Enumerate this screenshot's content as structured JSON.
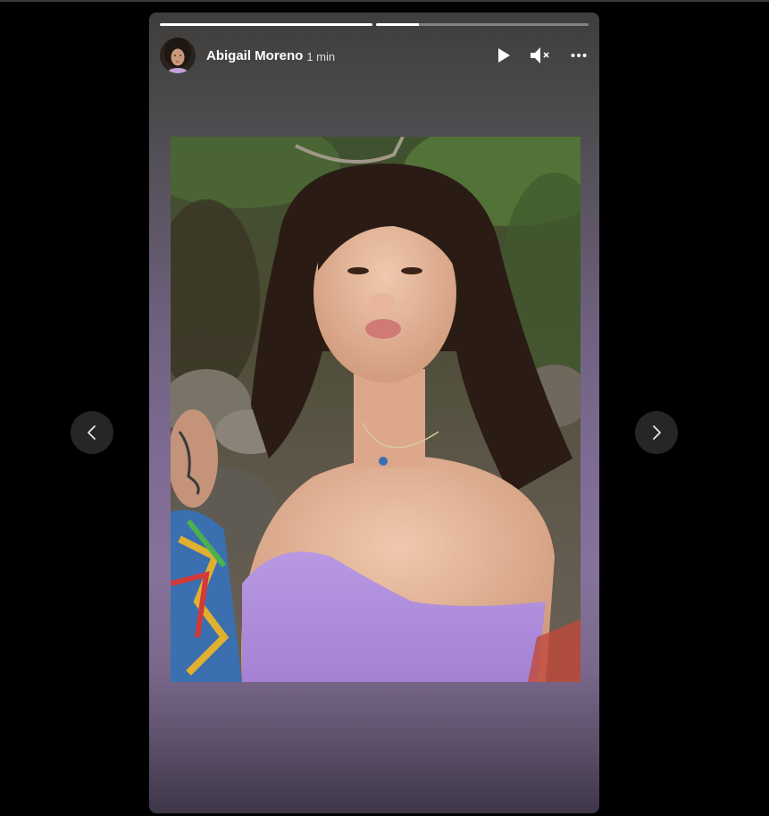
{
  "story": {
    "user_name": "Abigail Moreno",
    "time_ago": "1 min",
    "progress": [
      {
        "fraction": 1.0
      },
      {
        "fraction": 0.2
      }
    ],
    "controls": {
      "play_icon": "play-icon",
      "mute_icon": "muted-speaker-icon",
      "more_icon": "more-options-icon"
    },
    "photo_alt": "Selfie of a woman in a lilac strapless top outdoors"
  },
  "nav": {
    "prev_icon": "chevron-left-icon",
    "next_icon": "chevron-right-icon"
  },
  "colors": {
    "background": "#000000",
    "story_gradient_mid": "#7e6a92",
    "nav_button": "#262626",
    "top_accent": "#c8a2e0"
  }
}
